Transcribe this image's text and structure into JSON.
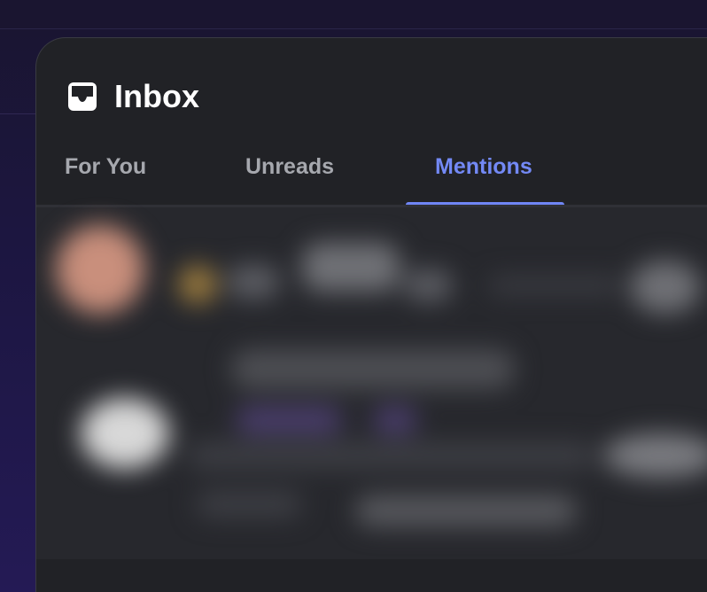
{
  "header": {
    "title": "Inbox",
    "icon": "inbox-icon"
  },
  "tabs": [
    {
      "label": "For You",
      "active": false
    },
    {
      "label": "Unreads",
      "active": false
    },
    {
      "label": "Mentions",
      "active": true
    }
  ],
  "colors": {
    "panel_bg": "#212226",
    "active_tab": "#7389f5",
    "inactive_tab": "#a6a8ae",
    "title": "#ffffff"
  }
}
